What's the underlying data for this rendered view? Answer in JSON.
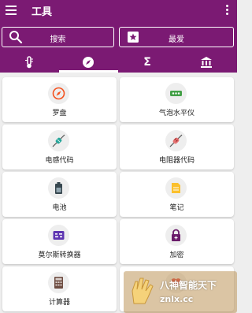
{
  "app": {
    "title": "工具"
  },
  "buttons": {
    "search_label": "搜索",
    "favorites_label": "最爱"
  },
  "tabs": [
    {
      "name": "tab-measure",
      "icon": "thermometer-icon"
    },
    {
      "name": "tab-tools",
      "icon": "compass-icon",
      "active": true
    },
    {
      "name": "tab-math",
      "icon": "sigma-icon"
    },
    {
      "name": "tab-finance",
      "icon": "bank-icon"
    }
  ],
  "cards": [
    {
      "label": "罗盘",
      "icon": "compass-icon",
      "color": "#f4511e"
    },
    {
      "label": "气泡水平仪",
      "icon": "bubble-level-icon",
      "color": "#43a047"
    },
    {
      "label": "电感代码",
      "icon": "inductor-icon",
      "color": "#26a69a"
    },
    {
      "label": "电阻器代码",
      "icon": "resistor-icon",
      "color": "#e57373"
    },
    {
      "label": "电池",
      "icon": "battery-icon",
      "color": "#37474f"
    },
    {
      "label": "笔记",
      "icon": "note-icon",
      "color": "#fbc02d"
    },
    {
      "label": "莫尔斯转换器",
      "icon": "morse-icon",
      "color": "#5e35b1"
    },
    {
      "label": "加密",
      "icon": "lock-icon",
      "color": "#6a1b6a"
    },
    {
      "label": "计算器",
      "icon": "calculator-icon",
      "color": "#6d4c41"
    },
    {
      "label": "",
      "icon": "heart-icon",
      "color": "#e53935"
    }
  ],
  "watermark": {
    "text": "八神智能天下",
    "url": "znlx.cc"
  },
  "colors": {
    "primary": "#7b1a73",
    "background": "#eeeeee",
    "card": "#ffffff"
  }
}
